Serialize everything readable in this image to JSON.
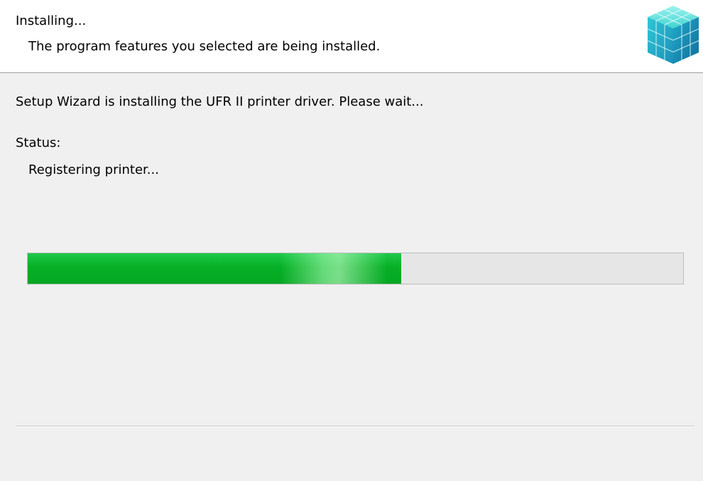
{
  "header": {
    "title": "Installing...",
    "subtitle": "The program features you selected are being installed.",
    "logo_icon": "blue-cube-installer-icon"
  },
  "main": {
    "message": "Setup Wizard is installing the UFR II printer driver. Please wait...",
    "status_label": "Status:",
    "status_value": "Registering printer...",
    "progress": {
      "fraction": 0.57,
      "fill_color": "#06b025",
      "track_color": "#e6e6e6"
    }
  },
  "colors": {
    "header_bg": "#ffffff",
    "body_bg": "#f0f0f0",
    "divider": "#a0a0a0"
  }
}
